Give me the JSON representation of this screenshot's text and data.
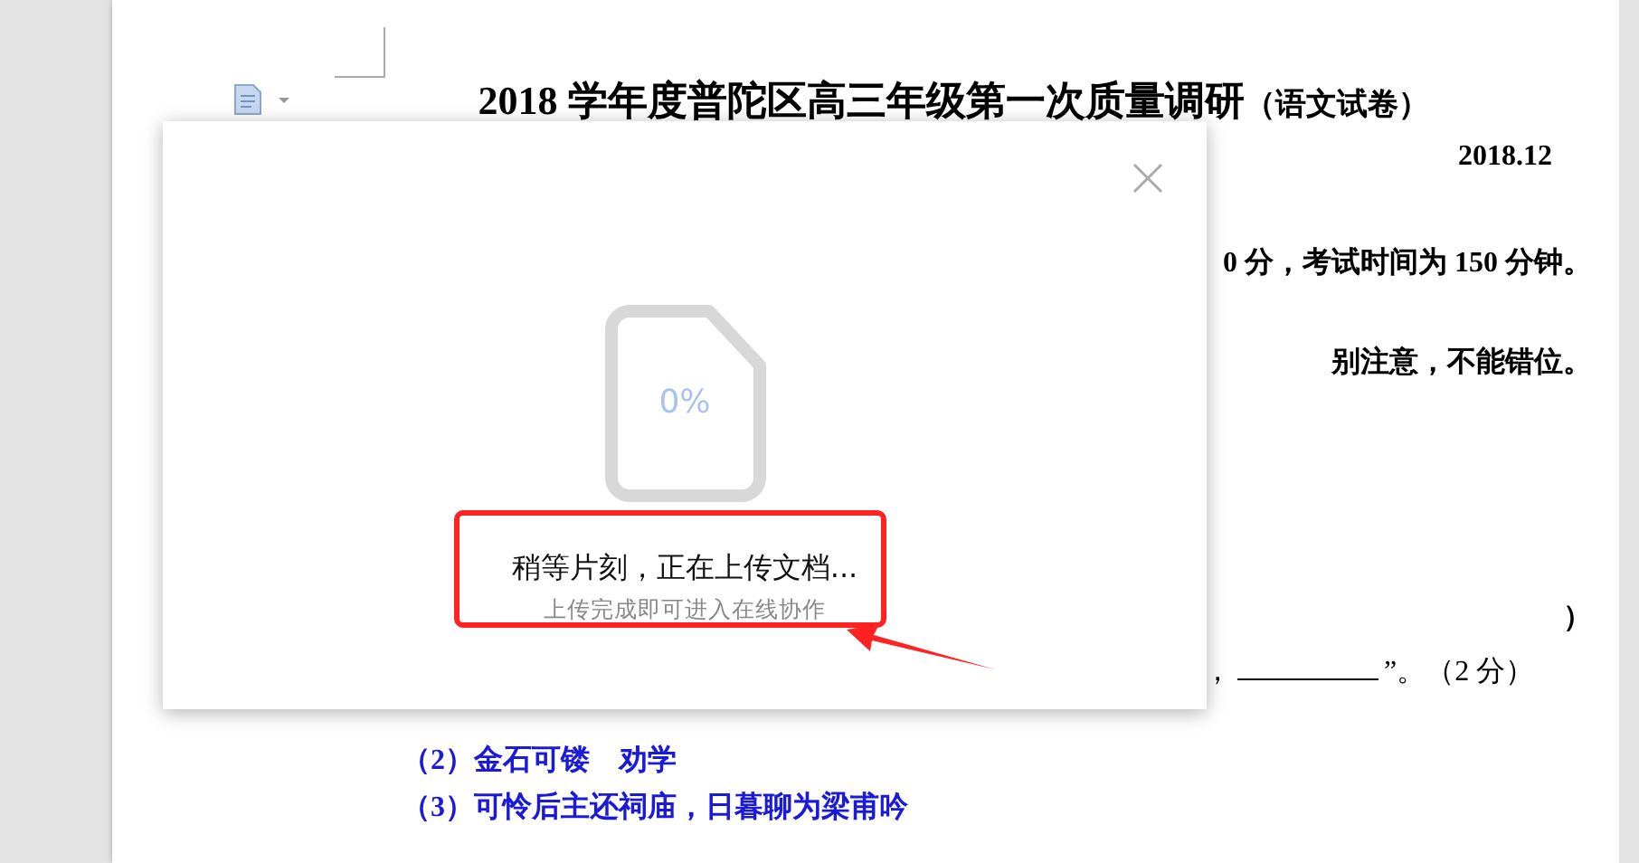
{
  "document": {
    "title": "2018 学年度普陀区高三年级第一次质量调研",
    "title_suffix": "（语文试卷）",
    "date": "2018.12",
    "lines": [
      {
        "kind": "plain",
        "text": "0 分，考试时间为 150 分钟。"
      },
      {
        "kind": "plain",
        "text": "别注意，不能错位。"
      },
      {
        "kind": "plain",
        "text": "）"
      },
      {
        "kind": "blank",
        "before": "，",
        "after": "”。（2 分）"
      },
      {
        "kind": "answer",
        "text": "（2）金石可镂　劝学"
      },
      {
        "kind": "answer",
        "text": "（3）可怜后主还祠庙，日暮聊为梁甫吟"
      }
    ]
  },
  "dialog": {
    "progress": "0%",
    "message": "稍等片刻，正在上传文档...",
    "hint": "上传完成即可进入在线协作"
  }
}
